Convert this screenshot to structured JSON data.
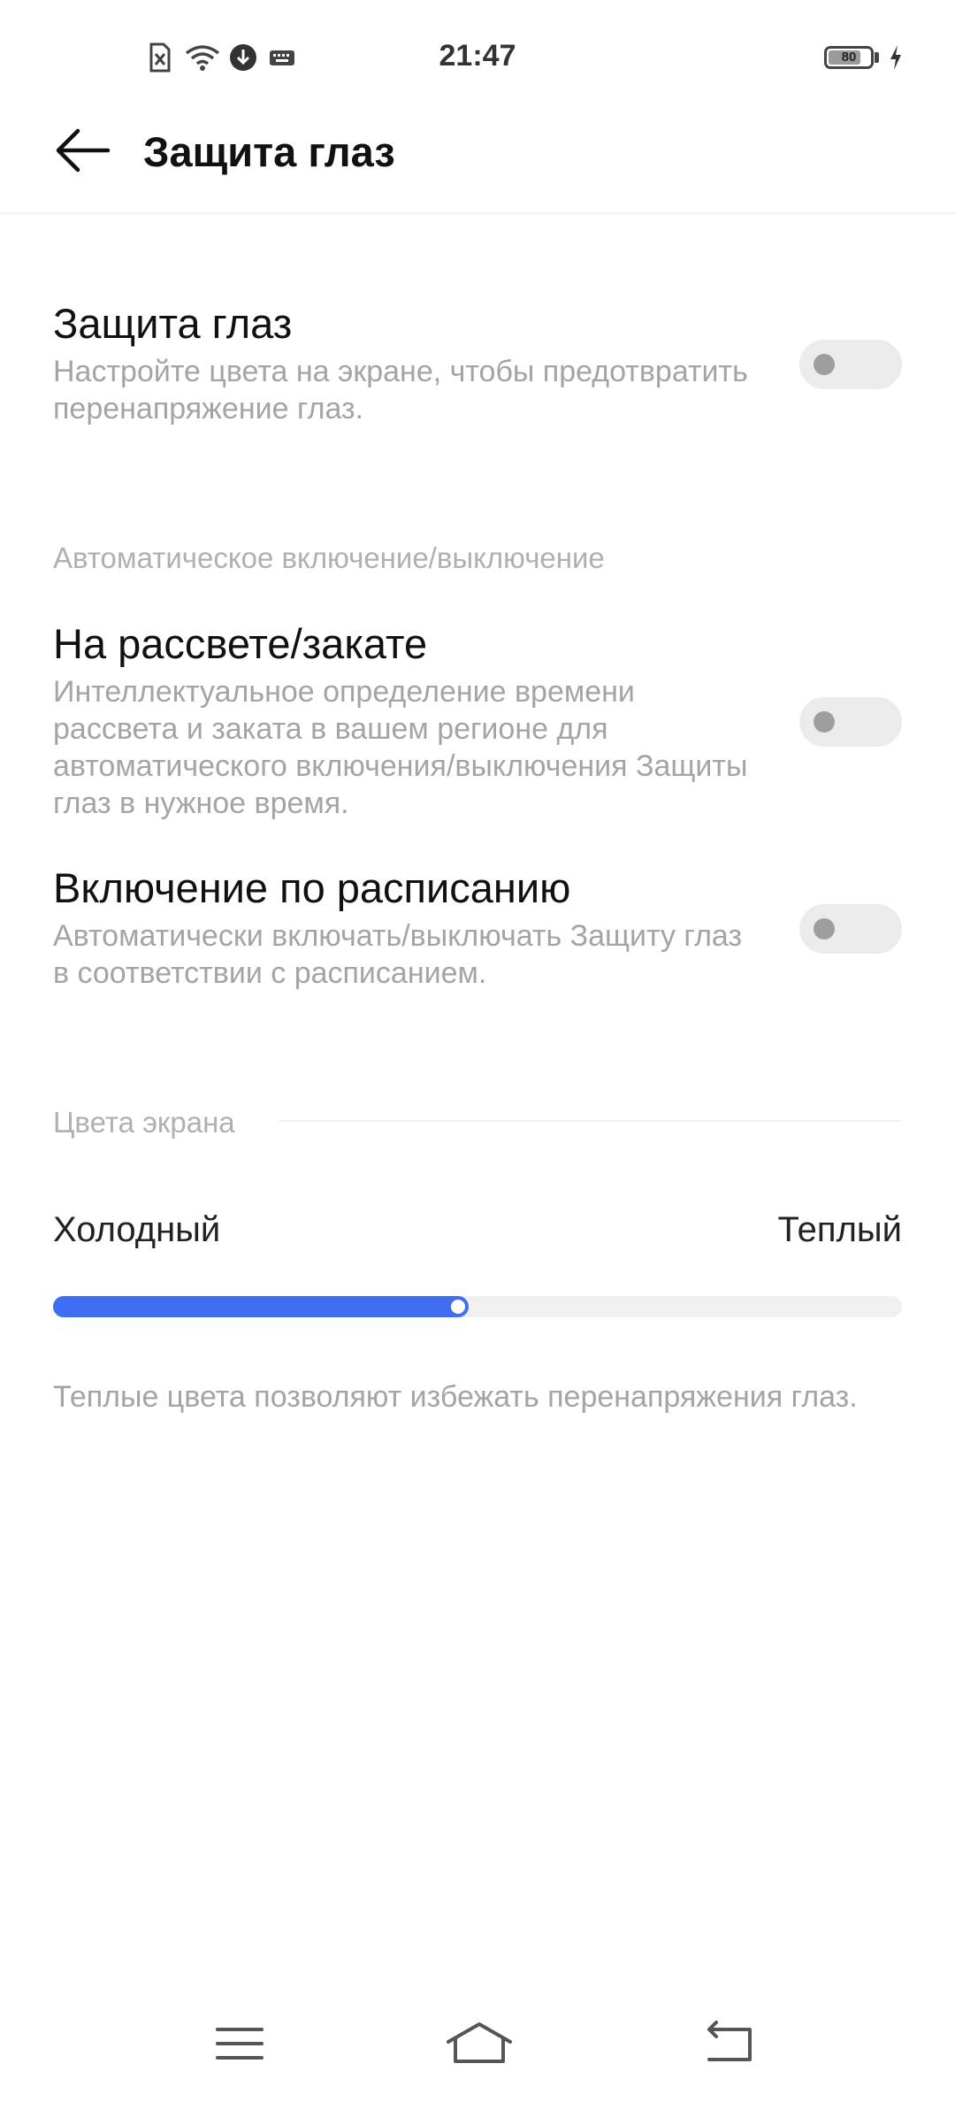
{
  "status_bar": {
    "time": "21:47",
    "battery_level": "80",
    "icons": [
      "sim-disabled-icon",
      "wifi-icon",
      "download-icon",
      "keyboard-icon",
      "battery-icon",
      "charging-bolt-icon"
    ]
  },
  "header": {
    "title": "Защита глаз",
    "back_icon": "back-arrow-icon"
  },
  "eye_protection": {
    "title": "Защита глаз",
    "subtitle": "Настройте цвета на экране, чтобы предотвратить перенапряжение глаз.",
    "enabled": false
  },
  "auto_section": {
    "header": "Автоматическое включение/выключение",
    "sunset": {
      "title": "На рассвете/закате",
      "subtitle": "Интеллектуальное определение времени рассвета и заката в вашем регионе для автоматического включения/выключения Защиты глаз в нужное время.",
      "enabled": false
    },
    "schedule": {
      "title": "Включение по расписанию",
      "subtitle": "Автоматически включать/выключать Защиту глаз в соответствии с расписанием.",
      "enabled": false
    }
  },
  "colors_section": {
    "header": "Цвета экрана",
    "cold_label": "Холодный",
    "warm_label": "Теплый",
    "slider_value_percent": 49,
    "hint": "Теплые цвета позволяют избежать перенапряжения глаз."
  },
  "colors": {
    "accent": "#3f6ef3",
    "toggle_off_track": "#ebebeb",
    "toggle_off_knob": "#9e9e9e"
  },
  "nav_bar": {
    "icons": [
      "menu-icon",
      "home-icon",
      "back-icon"
    ]
  }
}
